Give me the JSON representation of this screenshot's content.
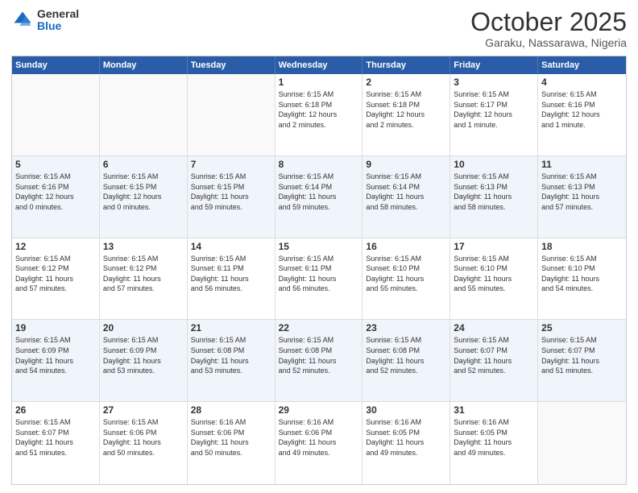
{
  "logo": {
    "general": "General",
    "blue": "Blue"
  },
  "header": {
    "month": "October 2025",
    "location": "Garaku, Nassarawa, Nigeria"
  },
  "days": [
    "Sunday",
    "Monday",
    "Tuesday",
    "Wednesday",
    "Thursday",
    "Friday",
    "Saturday"
  ],
  "weeks": [
    [
      {
        "day": "",
        "info": ""
      },
      {
        "day": "",
        "info": ""
      },
      {
        "day": "",
        "info": ""
      },
      {
        "day": "1",
        "info": "Sunrise: 6:15 AM\nSunset: 6:18 PM\nDaylight: 12 hours\nand 2 minutes."
      },
      {
        "day": "2",
        "info": "Sunrise: 6:15 AM\nSunset: 6:18 PM\nDaylight: 12 hours\nand 2 minutes."
      },
      {
        "day": "3",
        "info": "Sunrise: 6:15 AM\nSunset: 6:17 PM\nDaylight: 12 hours\nand 1 minute."
      },
      {
        "day": "4",
        "info": "Sunrise: 6:15 AM\nSunset: 6:16 PM\nDaylight: 12 hours\nand 1 minute."
      }
    ],
    [
      {
        "day": "5",
        "info": "Sunrise: 6:15 AM\nSunset: 6:16 PM\nDaylight: 12 hours\nand 0 minutes."
      },
      {
        "day": "6",
        "info": "Sunrise: 6:15 AM\nSunset: 6:15 PM\nDaylight: 12 hours\nand 0 minutes."
      },
      {
        "day": "7",
        "info": "Sunrise: 6:15 AM\nSunset: 6:15 PM\nDaylight: 11 hours\nand 59 minutes."
      },
      {
        "day": "8",
        "info": "Sunrise: 6:15 AM\nSunset: 6:14 PM\nDaylight: 11 hours\nand 59 minutes."
      },
      {
        "day": "9",
        "info": "Sunrise: 6:15 AM\nSunset: 6:14 PM\nDaylight: 11 hours\nand 58 minutes."
      },
      {
        "day": "10",
        "info": "Sunrise: 6:15 AM\nSunset: 6:13 PM\nDaylight: 11 hours\nand 58 minutes."
      },
      {
        "day": "11",
        "info": "Sunrise: 6:15 AM\nSunset: 6:13 PM\nDaylight: 11 hours\nand 57 minutes."
      }
    ],
    [
      {
        "day": "12",
        "info": "Sunrise: 6:15 AM\nSunset: 6:12 PM\nDaylight: 11 hours\nand 57 minutes."
      },
      {
        "day": "13",
        "info": "Sunrise: 6:15 AM\nSunset: 6:12 PM\nDaylight: 11 hours\nand 57 minutes."
      },
      {
        "day": "14",
        "info": "Sunrise: 6:15 AM\nSunset: 6:11 PM\nDaylight: 11 hours\nand 56 minutes."
      },
      {
        "day": "15",
        "info": "Sunrise: 6:15 AM\nSunset: 6:11 PM\nDaylight: 11 hours\nand 56 minutes."
      },
      {
        "day": "16",
        "info": "Sunrise: 6:15 AM\nSunset: 6:10 PM\nDaylight: 11 hours\nand 55 minutes."
      },
      {
        "day": "17",
        "info": "Sunrise: 6:15 AM\nSunset: 6:10 PM\nDaylight: 11 hours\nand 55 minutes."
      },
      {
        "day": "18",
        "info": "Sunrise: 6:15 AM\nSunset: 6:10 PM\nDaylight: 11 hours\nand 54 minutes."
      }
    ],
    [
      {
        "day": "19",
        "info": "Sunrise: 6:15 AM\nSunset: 6:09 PM\nDaylight: 11 hours\nand 54 minutes."
      },
      {
        "day": "20",
        "info": "Sunrise: 6:15 AM\nSunset: 6:09 PM\nDaylight: 11 hours\nand 53 minutes."
      },
      {
        "day": "21",
        "info": "Sunrise: 6:15 AM\nSunset: 6:08 PM\nDaylight: 11 hours\nand 53 minutes."
      },
      {
        "day": "22",
        "info": "Sunrise: 6:15 AM\nSunset: 6:08 PM\nDaylight: 11 hours\nand 52 minutes."
      },
      {
        "day": "23",
        "info": "Sunrise: 6:15 AM\nSunset: 6:08 PM\nDaylight: 11 hours\nand 52 minutes."
      },
      {
        "day": "24",
        "info": "Sunrise: 6:15 AM\nSunset: 6:07 PM\nDaylight: 11 hours\nand 52 minutes."
      },
      {
        "day": "25",
        "info": "Sunrise: 6:15 AM\nSunset: 6:07 PM\nDaylight: 11 hours\nand 51 minutes."
      }
    ],
    [
      {
        "day": "26",
        "info": "Sunrise: 6:15 AM\nSunset: 6:07 PM\nDaylight: 11 hours\nand 51 minutes."
      },
      {
        "day": "27",
        "info": "Sunrise: 6:15 AM\nSunset: 6:06 PM\nDaylight: 11 hours\nand 50 minutes."
      },
      {
        "day": "28",
        "info": "Sunrise: 6:16 AM\nSunset: 6:06 PM\nDaylight: 11 hours\nand 50 minutes."
      },
      {
        "day": "29",
        "info": "Sunrise: 6:16 AM\nSunset: 6:06 PM\nDaylight: 11 hours\nand 49 minutes."
      },
      {
        "day": "30",
        "info": "Sunrise: 6:16 AM\nSunset: 6:05 PM\nDaylight: 11 hours\nand 49 minutes."
      },
      {
        "day": "31",
        "info": "Sunrise: 6:16 AM\nSunset: 6:05 PM\nDaylight: 11 hours\nand 49 minutes."
      },
      {
        "day": "",
        "info": ""
      }
    ]
  ]
}
